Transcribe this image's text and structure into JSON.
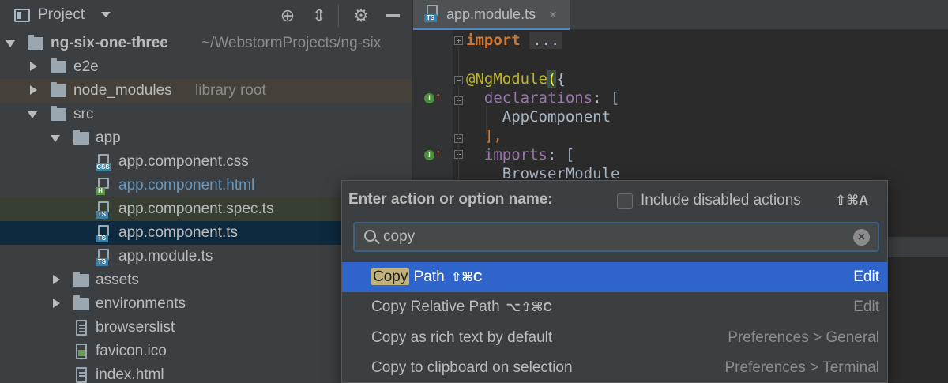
{
  "project_panel": {
    "title": "Project",
    "tree": [
      {
        "label": "ng-six-one-three",
        "extra": "~/WebstormProjects/ng-six",
        "kind": "root"
      },
      {
        "label": "e2e",
        "kind": "folder"
      },
      {
        "label": "node_modules",
        "extra": "library root",
        "kind": "folder"
      },
      {
        "label": "src",
        "kind": "folder"
      },
      {
        "label": "app",
        "kind": "folder"
      },
      {
        "label": "app.component.css",
        "icon": "CSS"
      },
      {
        "label": "app.component.html",
        "icon": "H"
      },
      {
        "label": "app.component.spec.ts",
        "icon": "TS"
      },
      {
        "label": "app.component.ts",
        "icon": "TS"
      },
      {
        "label": "app.module.ts",
        "icon": "TS"
      },
      {
        "label": "assets",
        "kind": "folder"
      },
      {
        "label": "environments",
        "kind": "folder"
      },
      {
        "label": "browserslist",
        "kind": "file"
      },
      {
        "label": "favicon.ico",
        "kind": "image"
      },
      {
        "label": "index.html",
        "kind": "file"
      }
    ]
  },
  "editor": {
    "tab": {
      "label": "app.module.ts",
      "badge": "TS",
      "close": "×"
    },
    "code": {
      "l1_kw": "import",
      "l1_dots": "...",
      "l2_anno": "@NgModule",
      "l2_paren": "(",
      "l2_brace": "{",
      "l3_prop": "declarations",
      "l3_rest": ": [",
      "l4": "AppComponent",
      "l5": "],",
      "l6_prop": "imports",
      "l6_rest": ": [",
      "l7": "BrowserModule"
    },
    "gutter_badge": "I"
  },
  "find_action": {
    "title": "Enter action or option name:",
    "include_disabled_label": "Include disabled actions",
    "include_disabled_shortcut": "⇧⌘A",
    "include_disabled_checked": false,
    "search_value": "copy",
    "clear_symbol": "×",
    "results": [
      {
        "match": "Copy",
        "rest": " Path",
        "shortcut": "⇧⌘C",
        "group": "Edit"
      },
      {
        "match": "",
        "name": "Copy Relative Path",
        "shortcut": "⌥⇧⌘C",
        "group": "Edit"
      },
      {
        "match": "",
        "name": "Copy as rich text by default",
        "shortcut": "",
        "group": "Preferences > General"
      },
      {
        "match": "",
        "name": "Copy to clipboard on selection",
        "shortcut": "",
        "group": "Preferences > Terminal"
      }
    ]
  },
  "colors": {
    "selection": "#2f65ca",
    "panel_bg": "#3c3f41",
    "editor_bg": "#2b2b2b",
    "keyword": "#cc7832",
    "property": "#9876aa",
    "annotation": "#bbb529"
  }
}
